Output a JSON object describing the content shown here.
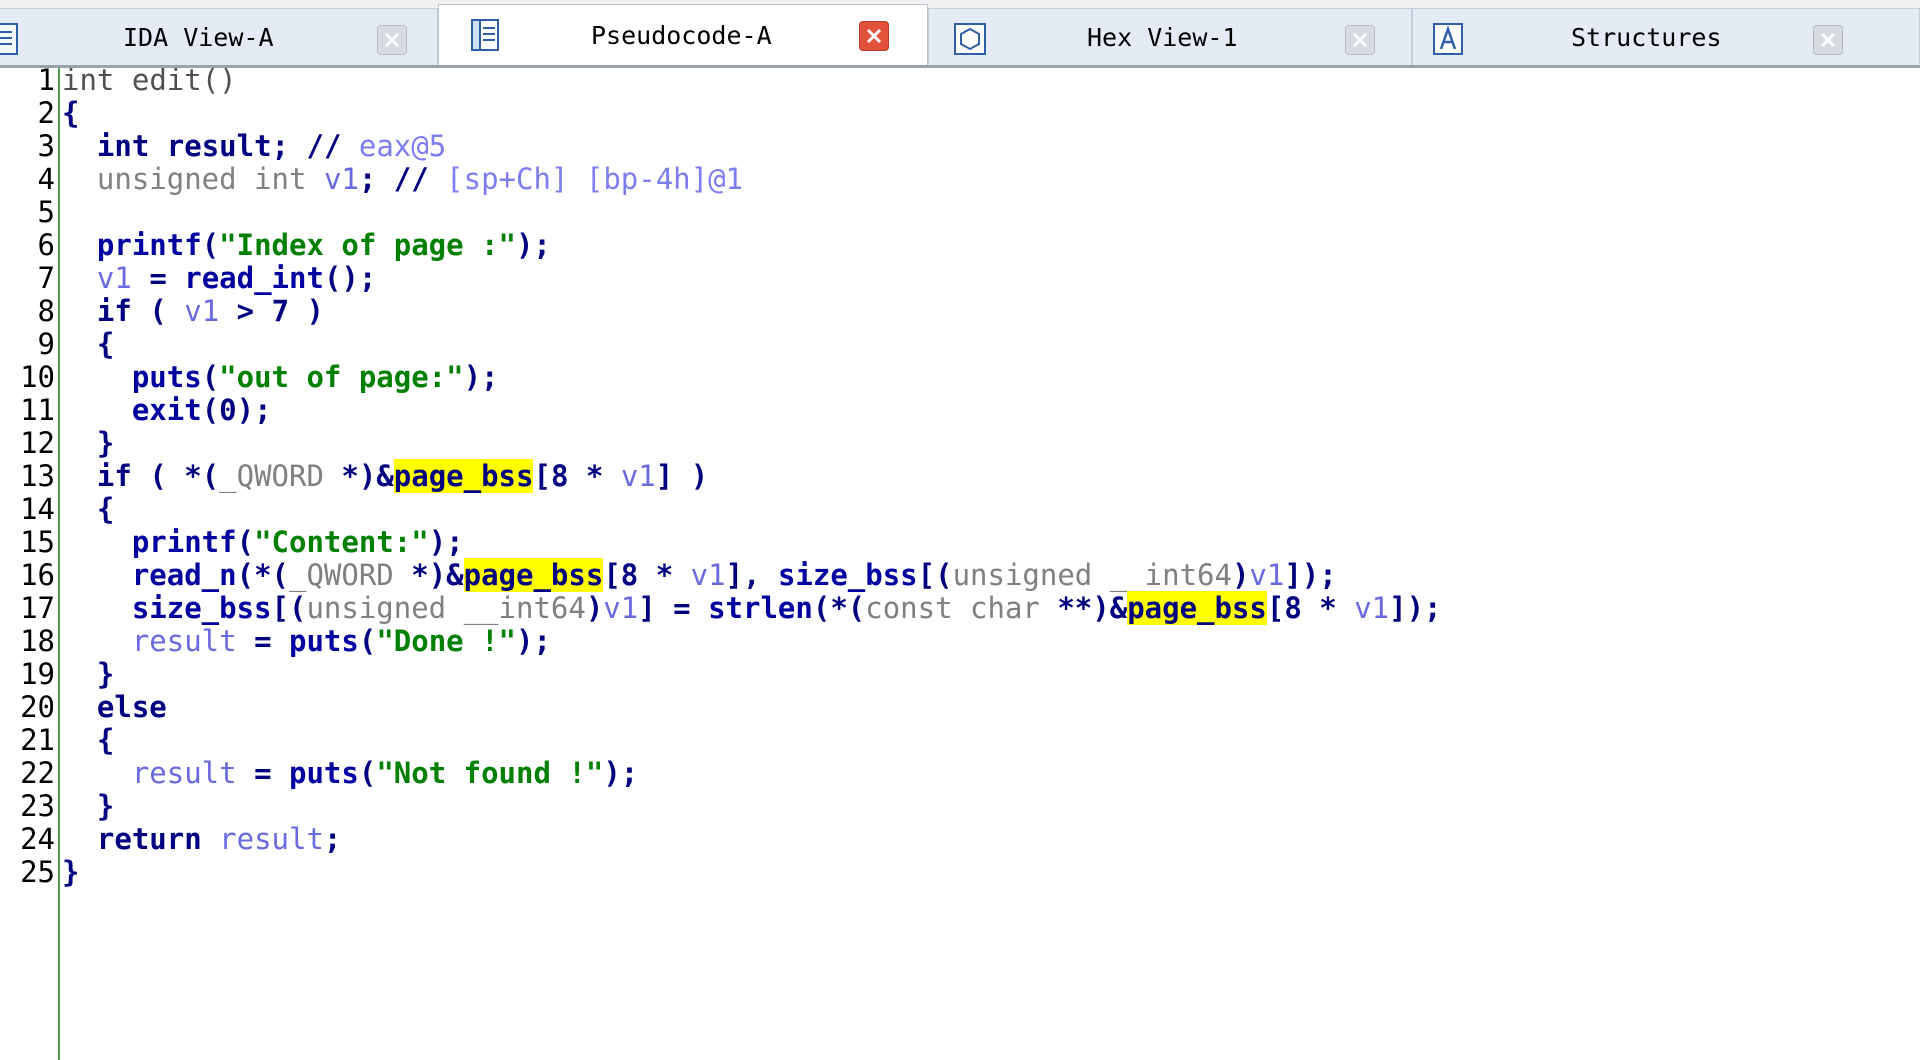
{
  "tabs": [
    {
      "label": "IDA View-A",
      "icon": "ida-view-icon",
      "active": false
    },
    {
      "label": "Pseudocode-A",
      "icon": "pseudocode-icon",
      "active": true
    },
    {
      "label": "Hex View-1",
      "icon": "hex-view-icon",
      "active": false
    },
    {
      "label": "Structures",
      "icon": "structures-icon",
      "active": false
    }
  ],
  "code": {
    "line_numbers": [
      "1",
      "2",
      "3",
      "4",
      "5",
      "6",
      "7",
      "8",
      "9",
      "10",
      "11",
      "12",
      "13",
      "14",
      "15",
      "16",
      "17",
      "18",
      "19",
      "20",
      "21",
      "22",
      "23",
      "24",
      "25"
    ],
    "lines": [
      "int edit()",
      "{",
      "  int result; // eax@5",
      "  unsigned int v1; // [sp+Ch] [bp-4h]@1",
      "",
      "  printf(\"Index of page :\");",
      "  v1 = read_int();",
      "  if ( v1 > 7 )",
      "  {",
      "    puts(\"out of page:\");",
      "    exit(0);",
      "  }",
      "  if ( *(_QWORD *)&page_bss[8 * v1] )",
      "  {",
      "    printf(\"Content:\");",
      "    read_n(*(_QWORD *)&page_bss[8 * v1], size_bss[(unsigned __int64)v1]);",
      "    size_bss[(unsigned __int64)v1] = strlen(*(const char **)&page_bss[8 * v1]);",
      "    result = puts(\"Done !\");",
      "  }",
      "  else",
      "  {",
      "    result = puts(\"Not found !\");",
      "  }",
      "  return result;",
      "}"
    ]
  },
  "colors": {
    "keyword": "#000080",
    "string": "#008000",
    "variable": "#6a6ae0",
    "type": "#808080",
    "highlight": "#ffff00",
    "active_close": "#e2513a"
  }
}
